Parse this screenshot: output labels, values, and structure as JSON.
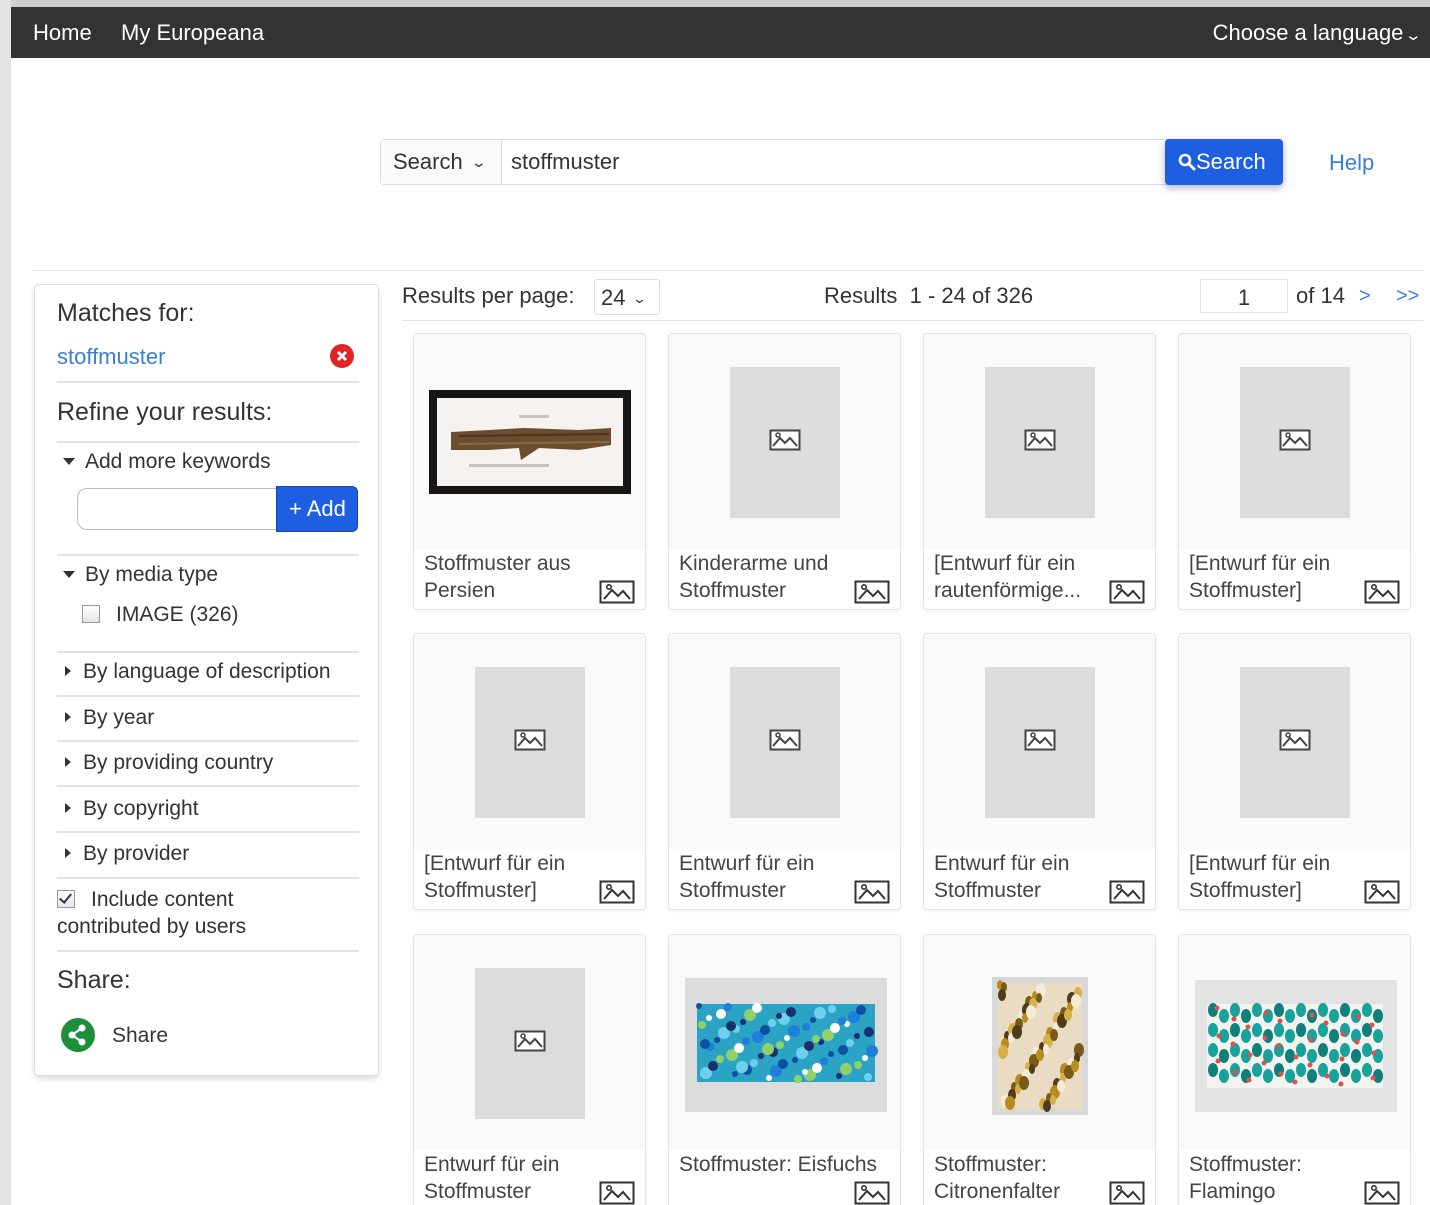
{
  "topnav": {
    "home": "Home",
    "my_europeana": "My Europeana",
    "language": "Choose a language"
  },
  "search": {
    "type_label": "Search",
    "query": "stoffmuster",
    "button_label": "Search",
    "help": "Help"
  },
  "sidebar": {
    "matches_for": "Matches for:",
    "keyword": "stoffmuster",
    "refine": "Refine your results:",
    "add_more_keywords": "Add more keywords",
    "add_button": "+ Add",
    "by_media_type": "By media type",
    "image_option": "IMAGE (326)",
    "image_checked": false,
    "collapsed_facets": [
      "By language of description",
      "By year",
      "By providing country",
      "By copyright",
      "By provider"
    ],
    "include_user_content_line1": "Include content",
    "include_user_content_line2": "contributed by users",
    "include_user_content_checked": true,
    "share_header": "Share:",
    "share_label": "Share"
  },
  "results": {
    "per_page_label": "Results per page:",
    "per_page_value": "24",
    "results_label": "Results",
    "results_range": "1 - 24 of 326",
    "current_page": "1",
    "of_pages": "of 14",
    "next": ">",
    "last": ">>"
  },
  "cards": [
    {
      "line1": "Stoffmuster aus",
      "line2": "Persien",
      "thumb": "photo-brown-fabric"
    },
    {
      "line1": "Kinderarme und",
      "line2": "Stoffmuster",
      "thumb": "placeholder"
    },
    {
      "line1": "[Entwurf für ein",
      "line2": "rautenförmige...",
      "thumb": "placeholder"
    },
    {
      "line1": "[Entwurf für ein",
      "line2": "Stoffmuster]",
      "thumb": "placeholder"
    },
    {
      "line1": "[Entwurf für ein",
      "line2": "Stoffmuster]",
      "thumb": "placeholder"
    },
    {
      "line1": "Entwurf für ein",
      "line2": "Stoffmuster",
      "thumb": "placeholder"
    },
    {
      "line1": "Entwurf für ein",
      "line2": "Stoffmuster",
      "thumb": "placeholder"
    },
    {
      "line1": "[Entwurf für ein",
      "line2": "Stoffmuster]",
      "thumb": "placeholder"
    },
    {
      "line1": "Entwurf für ein",
      "line2": "Stoffmuster",
      "thumb": "placeholder"
    },
    {
      "line1": "Stoffmuster: Eisfuchs",
      "line2": "",
      "thumb": "photo-blue-pattern"
    },
    {
      "line1": "Stoffmuster:",
      "line2": "Citronenfalter",
      "thumb": "photo-yellow-pattern"
    },
    {
      "line1": "Stoffmuster:",
      "line2": "Flamingo",
      "thumb": "photo-teal-pattern"
    }
  ],
  "colors": {
    "topbar": "#333333",
    "accent_blue": "#1e5ee0",
    "link_blue": "#3a7fd5",
    "remove_red": "#e02424",
    "share_green": "#1d8f3a"
  }
}
